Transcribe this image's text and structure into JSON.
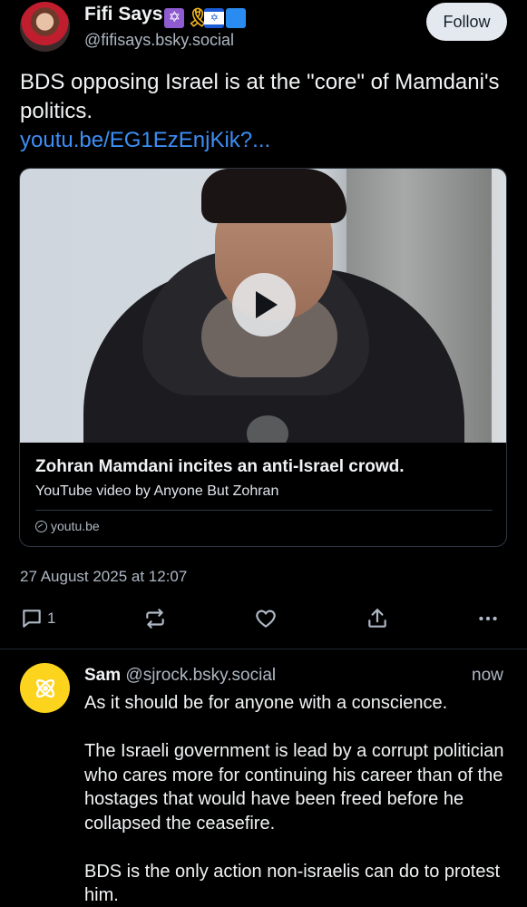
{
  "post": {
    "author_name": "Fifi Says",
    "author_emojis": [
      "star-of-david",
      "yellow-ribbon",
      "israel-flag",
      "blue-square"
    ],
    "author_handle": "@fifisays.bsky.social",
    "follow_label": "Follow",
    "text": "BDS opposing Israel is at the \"core\" of Mamdani's politics.",
    "link": "youtu.be/EG1EzEnjKik?...",
    "embed": {
      "title": "Zohran Mamdani incites an anti-Israel crowd.",
      "description": "YouTube video by Anyone But Zohran",
      "domain": "youtu.be"
    },
    "timestamp": "27 August 2025 at 12:07",
    "actions": {
      "reply_count": "1"
    }
  },
  "reply": {
    "author_name": "Sam",
    "author_handle": "@sjrock.bsky.social",
    "time": "now",
    "paragraphs": [
      "As it should be for anyone with a conscience.",
      "The Israeli government is lead by a corrupt politician who cares more for continuing his career than of the hostages that would have been freed before he collapsed the ceasefire.",
      "BDS is the only action non-israelis can do to protest him."
    ]
  },
  "colors": {
    "background": "#000000",
    "link": "#3d8ef5",
    "muted_text": "#aeb8c4",
    "reply_avatar": "#fcd41d"
  }
}
